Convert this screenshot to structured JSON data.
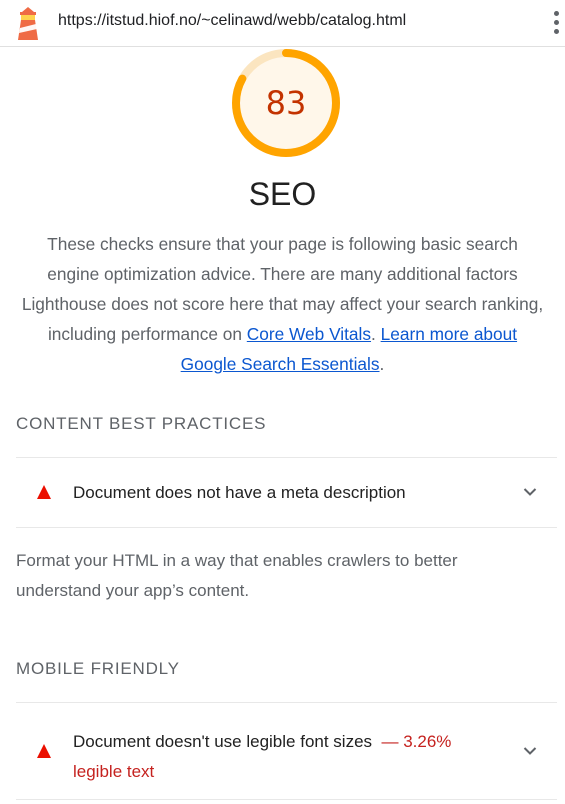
{
  "browser": {
    "url": "https://itstud.hiof.no/~celinawd/webb/catalog.html",
    "logo_icon": "lighthouse-icon",
    "menu_icon": "kebab-menu-icon"
  },
  "score": {
    "value": "83",
    "fraction": 0.83,
    "color": "#ffa400",
    "text_color": "#c33300",
    "fill": "#fff7ea"
  },
  "category": {
    "title": "SEO",
    "description_parts": {
      "p1": "These checks ensure that your page is following basic search engine optimization advice. There are many additional factors Lighthouse does not score here that may affect your search ranking, including performance on ",
      "link1": "Core Web Vitals",
      "p2": ". ",
      "link2": "Learn more about Google Search Essentials",
      "p3": "."
    }
  },
  "groups": [
    {
      "title": "CONTENT BEST PRACTICES",
      "audits": [
        {
          "title": "Document does not have a meta description",
          "status": "fail"
        }
      ],
      "description": "Format your HTML in a way that enables crawlers to better understand your app’s content."
    },
    {
      "title": "MOBILE FRIENDLY",
      "audits": [
        {
          "title": "Document doesn't use legible font sizes",
          "status": "fail",
          "display_value_dash": "—",
          "display_value_number": "3.26%",
          "display_value_rest": "legible text"
        }
      ]
    }
  ],
  "colors": {
    "fail": "#eb0f00",
    "average": "#ffa400",
    "link": "#0b57d0"
  }
}
